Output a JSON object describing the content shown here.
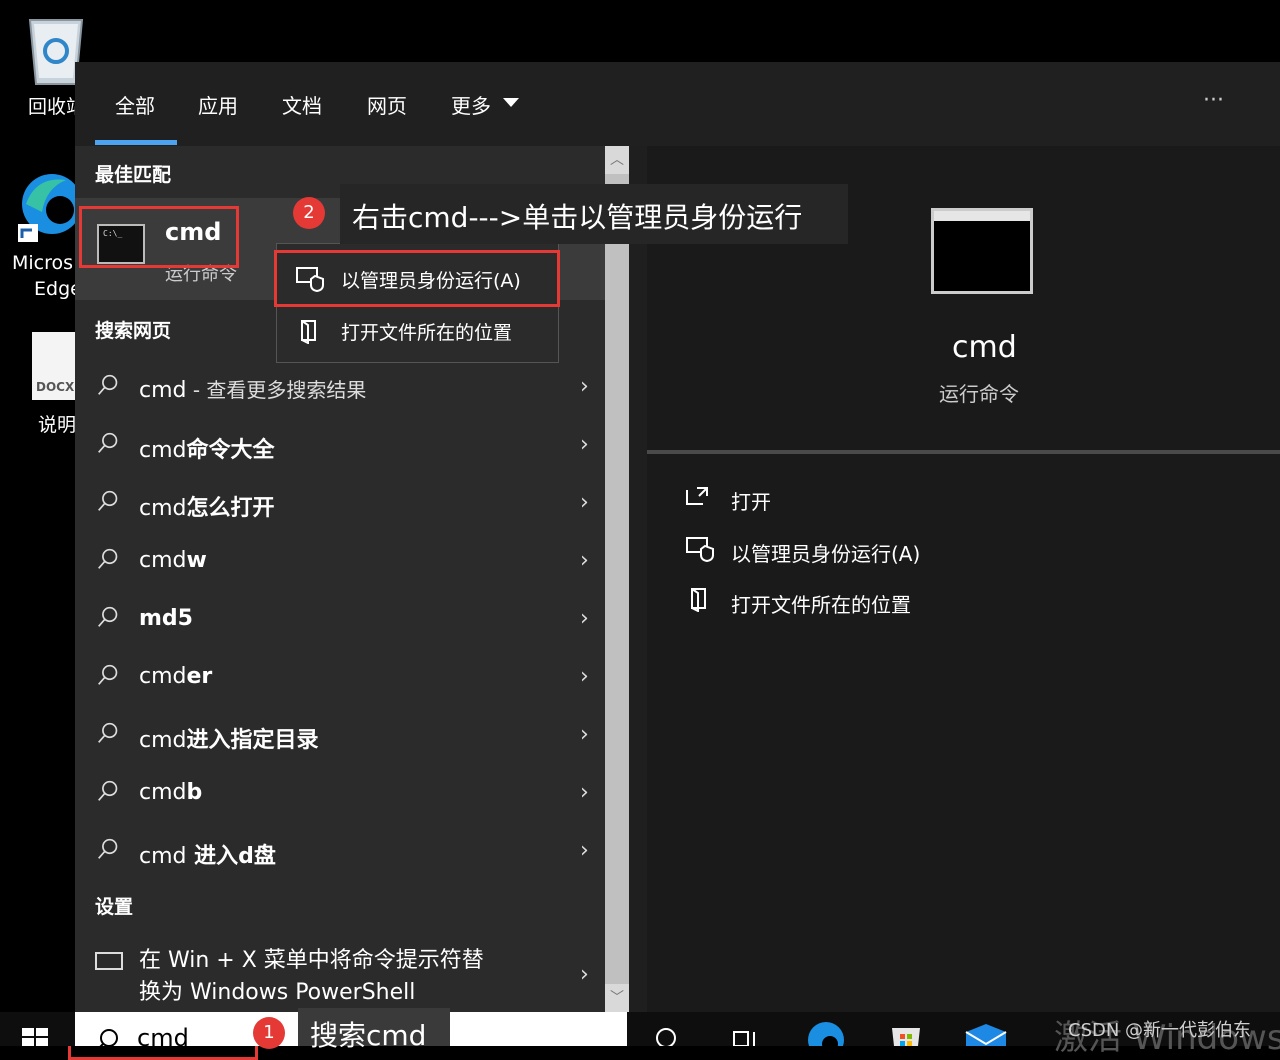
{
  "desktop": {
    "recycle_label": "回收站",
    "edge_label_1": "Micros",
    "edge_label_2": "Edge",
    "doc_label": "说明",
    "doc_badge": "DOCX"
  },
  "tabs": [
    "全部",
    "应用",
    "文档",
    "网页",
    "更多"
  ],
  "tabs_more_icon": "dropdown-arrow",
  "more_options": "···",
  "sections": {
    "best_match": "最佳匹配",
    "search_web": "搜索网页",
    "settings": "设置"
  },
  "best_match": {
    "title": "cmd",
    "subtitle": "运行命令"
  },
  "context_menu": [
    {
      "label": "以管理员身份运行(A)",
      "icon": "shield-run-icon"
    },
    {
      "label": "打开文件所在的位置",
      "icon": "folder-location-icon"
    }
  ],
  "web_results": [
    {
      "prefix": "cmd",
      "suffix": " - 查看更多搜索结果",
      "bold": false
    },
    {
      "prefix": "cmd",
      "suffix": "命令大全",
      "bold": true
    },
    {
      "prefix": "cmd",
      "suffix": "怎么打开",
      "bold": true
    },
    {
      "prefix": "cmd",
      "suffix": "w",
      "bold": true
    },
    {
      "prefix": "",
      "suffix": "md5",
      "bold": true
    },
    {
      "prefix": "cmd",
      "suffix": "er",
      "bold": true
    },
    {
      "prefix": "cmd",
      "suffix": "进入指定目录",
      "bold": true
    },
    {
      "prefix": "cmd",
      "suffix": "b",
      "bold": true
    },
    {
      "prefix": "cmd",
      "suffix": " 进入d盘",
      "bold": true
    }
  ],
  "settings_item": {
    "line1": "在 Win + X 菜单中将命令提示符替",
    "line2": "换为 Windows PowerShell"
  },
  "preview": {
    "title": "cmd",
    "subtitle": "运行命令",
    "actions": [
      {
        "label": "打开",
        "icon": "open-icon"
      },
      {
        "label": "以管理员身份运行(A)",
        "icon": "shield-run-icon"
      },
      {
        "label": "打开文件所在的位置",
        "icon": "folder-location-icon"
      }
    ]
  },
  "annotations": {
    "step1_number": "1",
    "step1_text": "搜索cmd",
    "step2_number": "2",
    "step2_text": "右击cmd--->单击以管理员身份运行"
  },
  "search": {
    "value": "cmd"
  },
  "watermarks": {
    "csdn": "CSDN @新一代彭伯东",
    "activate": "激活 Windows"
  },
  "colors": {
    "accent": "#4ea3f1",
    "highlight_red": "#e53935"
  }
}
